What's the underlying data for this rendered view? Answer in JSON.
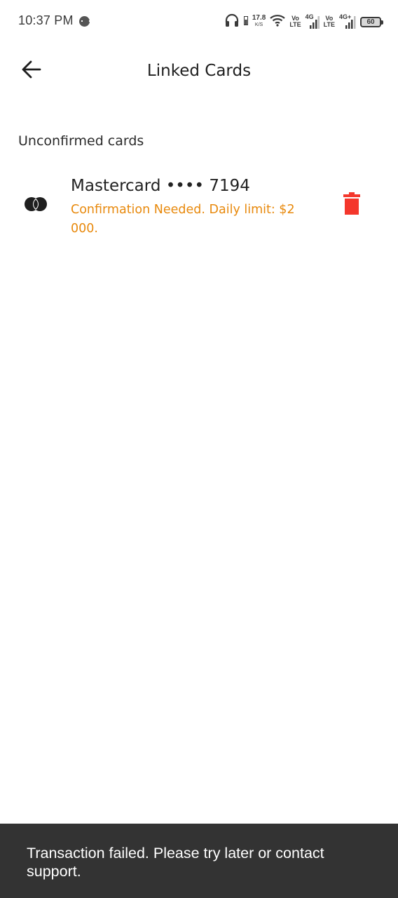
{
  "status_bar": {
    "time": "10:37 PM",
    "net_speed_value": "17.8",
    "net_speed_unit": "K/S",
    "sim1_volte_top": "Vo",
    "sim1_volte_bottom": "LTE",
    "sim1_network": "4G",
    "sim2_volte_top": "Vo",
    "sim2_volte_bottom": "LTE",
    "sim2_network": "4G+",
    "battery_level": "60",
    "icons": [
      "message-icon",
      "headphones-icon",
      "wifi-icon",
      "signal-icon",
      "battery-icon"
    ]
  },
  "header": {
    "title": "Linked Cards",
    "back_icon": "arrow-left-icon"
  },
  "section": {
    "title": "Unconfirmed cards"
  },
  "cards": [
    {
      "title": "Mastercard •••• 7194",
      "subtitle": "Confirmation Needed. Daily limit: $2 000.",
      "logo_icon": "mastercard-icon",
      "delete_icon": "trash-icon"
    }
  ],
  "snackbar": {
    "message": "Transaction failed. Please try later or contact support."
  },
  "colors": {
    "warning": "#e8890c",
    "delete": "#f4372c",
    "snackbar_bg": "#333333"
  }
}
